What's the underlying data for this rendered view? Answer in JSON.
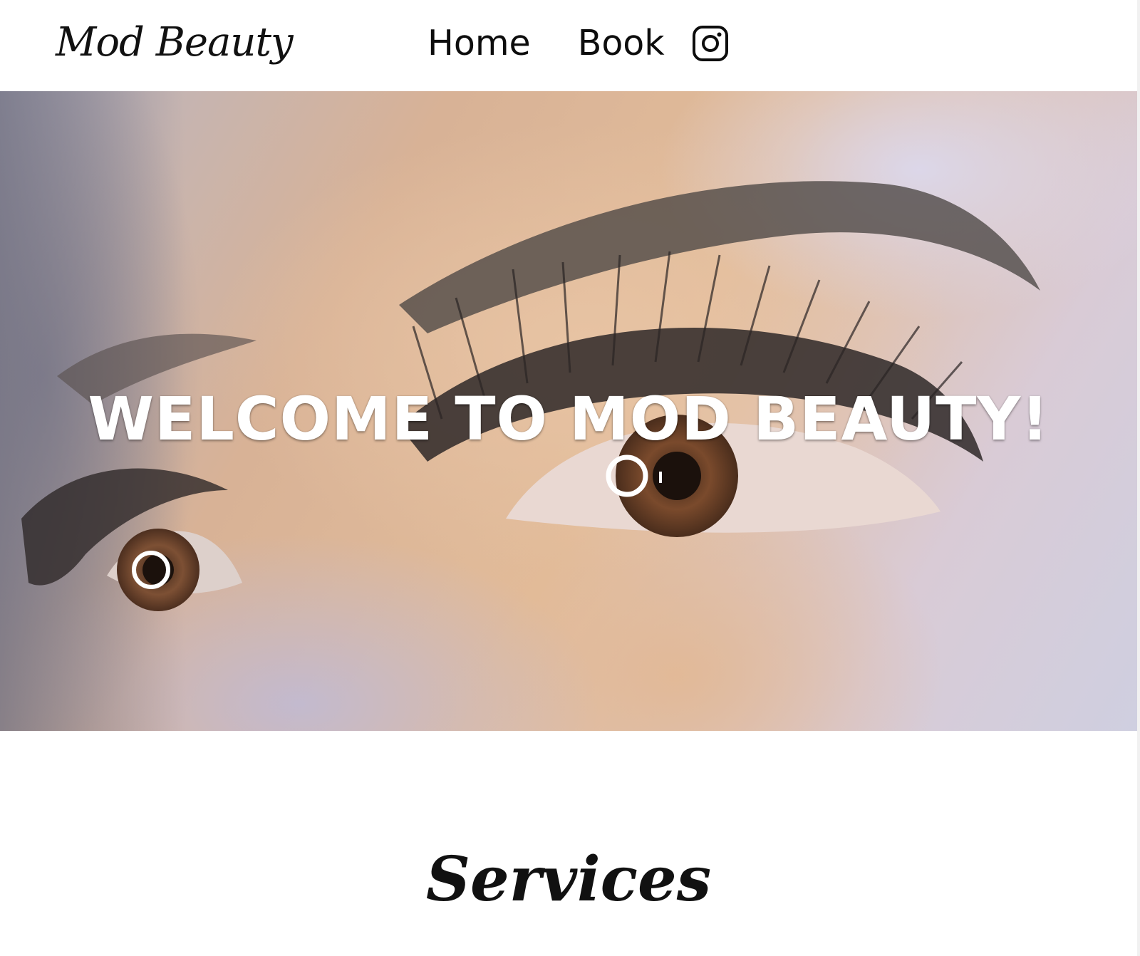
{
  "header": {
    "logo": "Mod Beauty",
    "nav": [
      {
        "label": "Home"
      },
      {
        "label": "Book"
      }
    ],
    "social_icon": "instagram-icon"
  },
  "hero": {
    "title": "WELCOME TO MOD BEAUTY!",
    "image": "close-up of eye with lash extensions"
  },
  "services": {
    "heading": "Services"
  },
  "colors": {
    "background": "#ffffff",
    "text": "#111111",
    "hero_text": "#ffffff"
  }
}
